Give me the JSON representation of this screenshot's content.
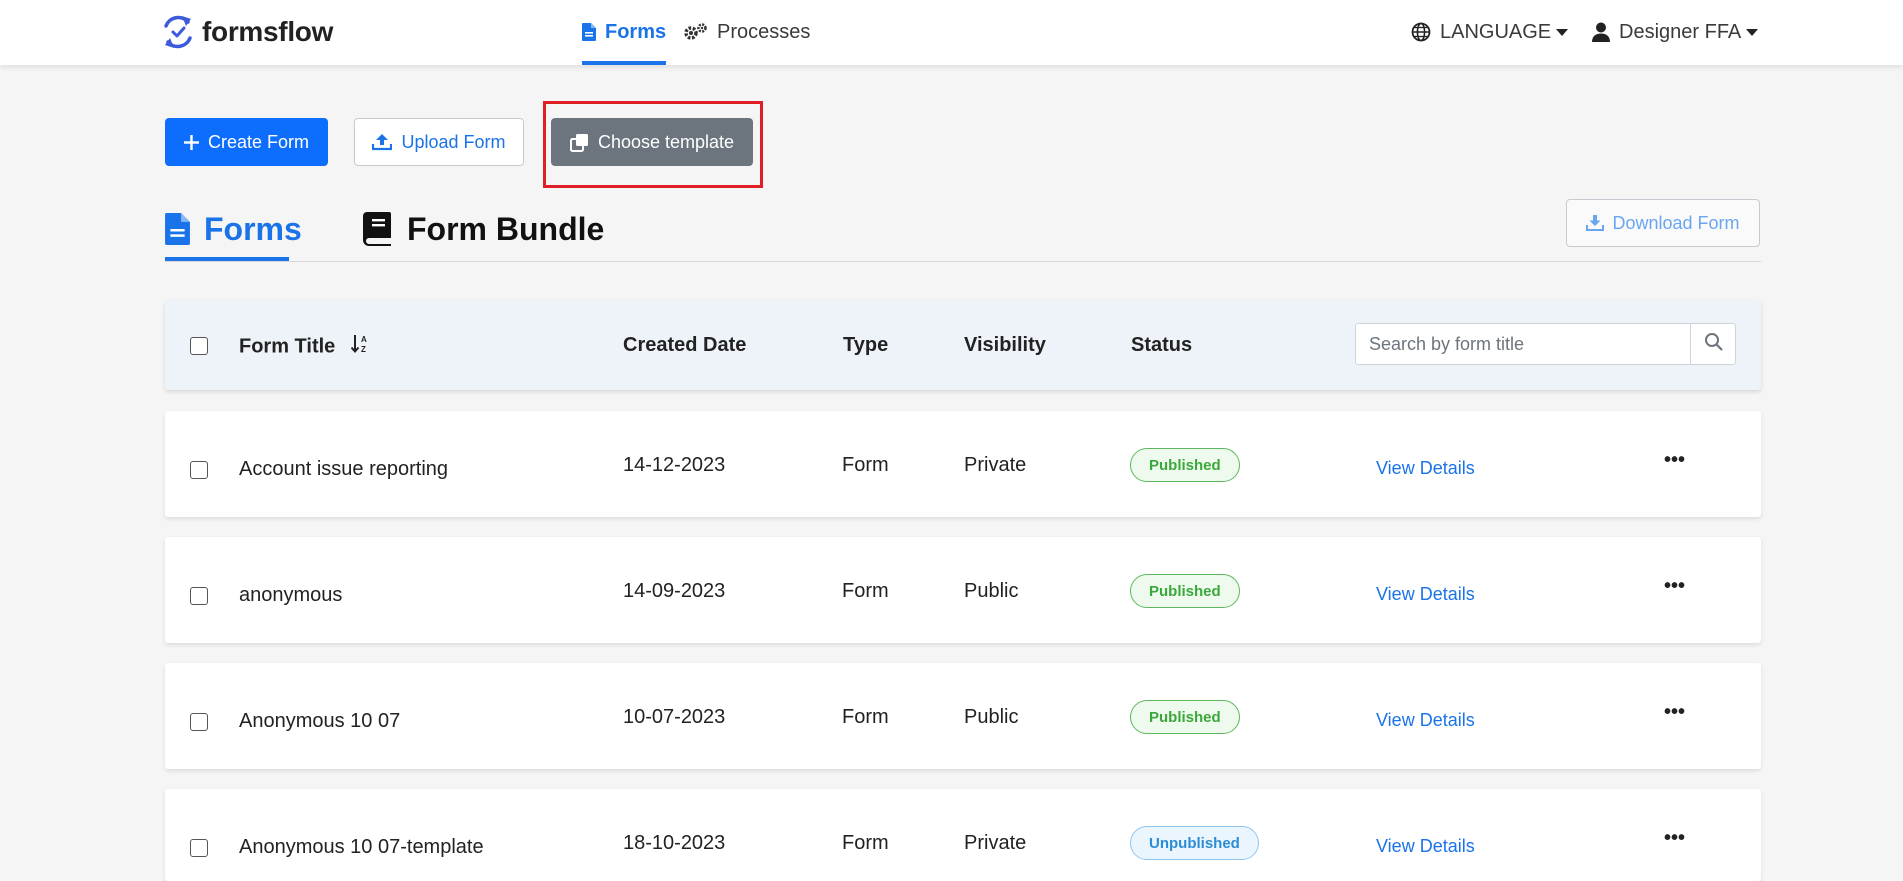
{
  "brand": {
    "name": "formsflow"
  },
  "nav": {
    "forms": "Forms",
    "processes": "Processes",
    "language": "LANGUAGE",
    "user": "Designer FFA"
  },
  "actions": {
    "create": "Create Form",
    "upload": "Upload Form",
    "template": "Choose template",
    "download": "Download Form"
  },
  "tabs": {
    "forms": "Forms",
    "bundle": "Form Bundle"
  },
  "table": {
    "headers": {
      "title": "Form Title",
      "created": "Created Date",
      "type": "Type",
      "visibility": "Visibility",
      "status": "Status"
    },
    "search_placeholder": "Search by form title",
    "rows": [
      {
        "title": "Account issue reporting",
        "created": "14-12-2023",
        "type": "Form",
        "visibility": "Private",
        "status": "Published",
        "action": "View Details"
      },
      {
        "title": "anonymous",
        "created": "14-09-2023",
        "type": "Form",
        "visibility": "Public",
        "status": "Published",
        "action": "View Details"
      },
      {
        "title": "Anonymous 10 07",
        "created": "10-07-2023",
        "type": "Form",
        "visibility": "Public",
        "status": "Published",
        "action": "View Details"
      },
      {
        "title": "Anonymous 10 07-template",
        "created": "18-10-2023",
        "type": "Form",
        "visibility": "Private",
        "status": "Unpublished",
        "action": "View Details"
      }
    ]
  },
  "icons": {
    "brand": "refresh-cycle-icon",
    "forms": "file-text-icon",
    "processes": "gears-icon",
    "language": "globe-icon",
    "user": "user-icon",
    "create": "plus-icon",
    "upload": "upload-icon",
    "template": "copy-icon",
    "bundle": "book-icon",
    "download": "download-icon",
    "search": "search-icon",
    "sort": "sort-alpha-down-icon",
    "more": "more-horizontal-icon"
  },
  "colors": {
    "primary": "#0d6efd",
    "link": "#1a73e8",
    "secondary": "#6c757d",
    "highlight": "#e01e25",
    "published": "#3aa83a",
    "unpublished": "#2c8dd6"
  }
}
